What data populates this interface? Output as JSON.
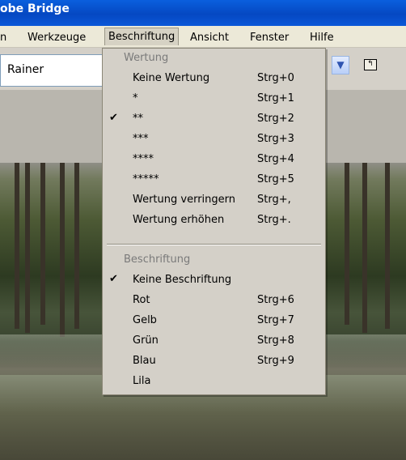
{
  "window": {
    "title": "obe Bridge"
  },
  "menubar": {
    "items": [
      {
        "label": "n"
      },
      {
        "label": "Werkzeuge"
      },
      {
        "label": "Beschriftung"
      },
      {
        "label": "Ansicht"
      },
      {
        "label": "Fenster"
      },
      {
        "label": "Hilfe"
      }
    ]
  },
  "path": {
    "value": "Rainer"
  },
  "menu": {
    "sections": [
      {
        "header": "Wertung",
        "items": [
          {
            "label": "Keine Wertung",
            "shortcut": "Strg+0",
            "checked": false
          },
          {
            "label": "*",
            "shortcut": "Strg+1",
            "checked": false
          },
          {
            "label": "**",
            "shortcut": "Strg+2",
            "checked": true
          },
          {
            "label": "***",
            "shortcut": "Strg+3",
            "checked": false
          },
          {
            "label": "****",
            "shortcut": "Strg+4",
            "checked": false
          },
          {
            "label": "*****",
            "shortcut": "Strg+5",
            "checked": false
          },
          {
            "label": "Wertung verringern",
            "shortcut": "Strg+,",
            "checked": false
          },
          {
            "label": "Wertung erhöhen",
            "shortcut": "Strg+.",
            "checked": false
          }
        ]
      },
      {
        "header": "Beschriftung",
        "items": [
          {
            "label": "Keine Beschriftung",
            "shortcut": "",
            "checked": true
          },
          {
            "label": "Rot",
            "shortcut": "Strg+6",
            "checked": false
          },
          {
            "label": "Gelb",
            "shortcut": "Strg+7",
            "checked": false
          },
          {
            "label": "Grün",
            "shortcut": "Strg+8",
            "checked": false
          },
          {
            "label": "Blau",
            "shortcut": "Strg+9",
            "checked": false
          },
          {
            "label": "Lila",
            "shortcut": "",
            "checked": false
          }
        ]
      }
    ],
    "check_glyph": "✔"
  },
  "colors": {
    "titlebar": "#0548c2",
    "menu_bg": "#d4d0c8",
    "header_text": "#7a7a7a"
  },
  "icons": {
    "dropdown": "chevron-down-icon",
    "up_folder": "up-folder-icon",
    "check": "check-icon"
  }
}
